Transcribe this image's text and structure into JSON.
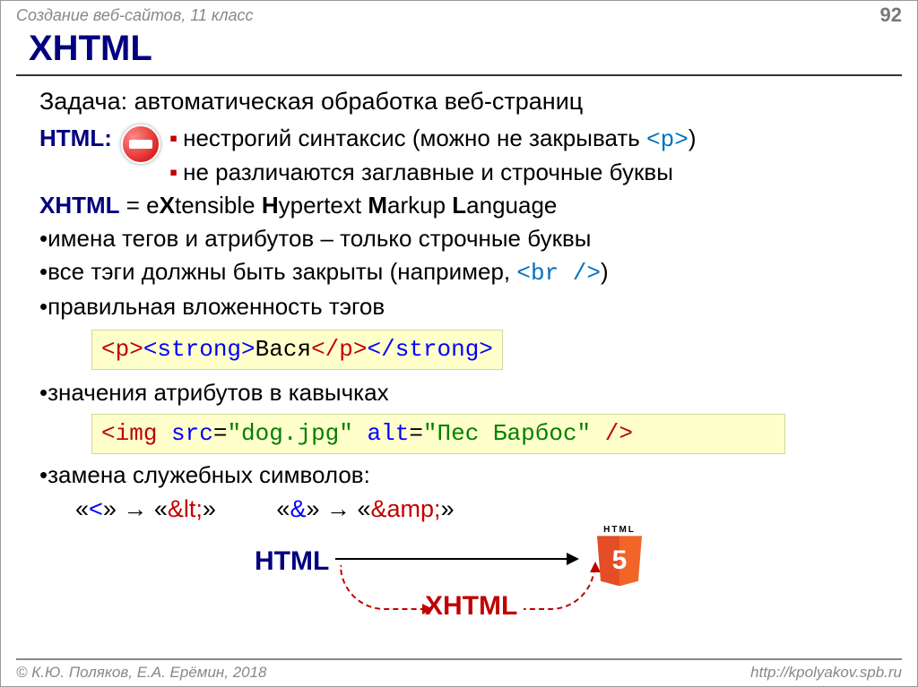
{
  "header": {
    "subject": "Создание веб-сайтов, 11 класс",
    "page": "92"
  },
  "title": "XHTML",
  "task": "Задача: автоматическая обработка веб-страниц",
  "html": {
    "label": "HTML",
    "b1_pre": "нестрогий синтаксис (можно не закрывать ",
    "b1_tag": "<p>",
    "b1_post": ")",
    "b2": "не различаются заглавные и строчные буквы"
  },
  "xhtml_expand": {
    "label": "XHTML",
    "eq": " = e",
    "x": "X",
    "t1": "tensible ",
    "h": "H",
    "t2": "ypertext ",
    "m": "M",
    "t3": "arkup ",
    "l": "L",
    "t4": "anguage"
  },
  "rule1": "имена тегов и атрибутов – только строчные буквы",
  "rule2": {
    "pre": "все тэги должны быть закрыты (например, ",
    "tag": "<br />",
    "post": ")"
  },
  "rule3": "правильная вложенность тэгов",
  "code1": {
    "p_open": "<p>",
    "s_open": "<strong>",
    "text": "Вася",
    "p_close": "</p>",
    "s_close": "</strong>"
  },
  "rule4": "значения атрибутов в кавычках",
  "code2": {
    "lt": "<",
    "tag": "img",
    "sp": " ",
    "a1": "src",
    "eq": "=",
    "v1": "\"dog.jpg\"",
    "a2": "alt",
    "v2": "\"Пес Барбос\"",
    "slash_gt": " />"
  },
  "rule5": "замена служебных символов:",
  "entities": {
    "lt_q1": "«",
    "lt_ch": "<",
    "lt_q2": "»  →  «",
    "lt_ent": "&lt;",
    "lt_q3": "»",
    "amp_q1": "«",
    "amp_ch": "&",
    "amp_q2": "»  →  «",
    "amp_ent": "&amp;",
    "amp_q3": "»"
  },
  "diagram": {
    "html_label": "HTML",
    "xhtml_label": "XHTML",
    "logo_text": "HTML"
  },
  "footer": {
    "copyright": "© К.Ю. Поляков, Е.А. Ерёмин, 2018",
    "url": "http://kpolyakov.spb.ru"
  }
}
